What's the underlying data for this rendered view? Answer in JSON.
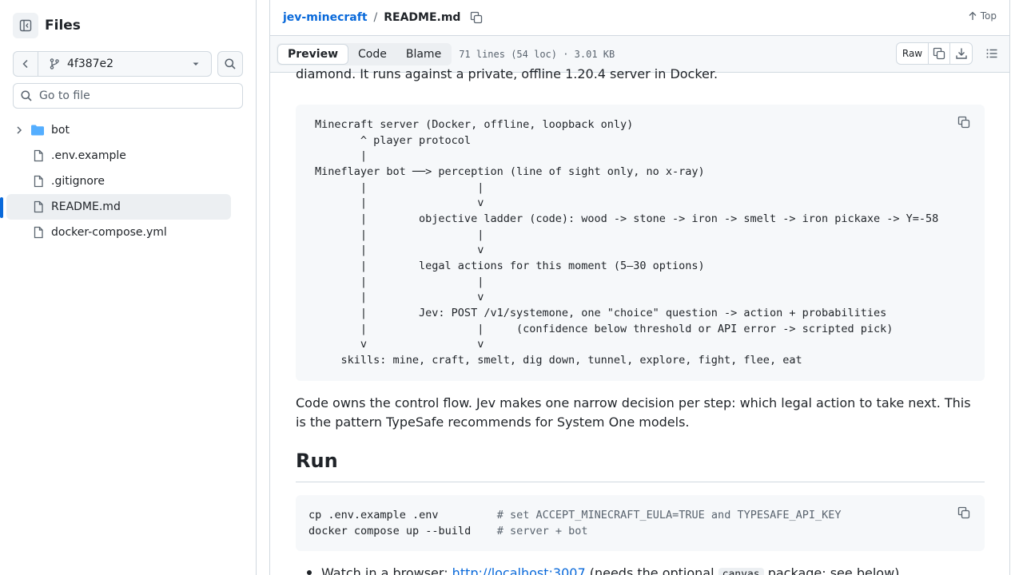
{
  "sidebar": {
    "title": "Files",
    "branch": "4f387e2",
    "goto_placeholder": "Go to file",
    "items": [
      {
        "label": "bot",
        "type": "folder"
      },
      {
        "label": ".env.example",
        "type": "file"
      },
      {
        "label": ".gitignore",
        "type": "file"
      },
      {
        "label": "README.md",
        "type": "file",
        "selected": true
      },
      {
        "label": "docker-compose.yml",
        "type": "file"
      }
    ]
  },
  "header": {
    "repo": "jev-minecraft",
    "separator": "/",
    "file": "README.md",
    "top_label": "Top"
  },
  "filebar": {
    "tabs": [
      "Preview",
      "Code",
      "Blame"
    ],
    "active_tab": "Preview",
    "meta": "71 lines (54 loc) · 3.01 KB",
    "raw_label": "Raw"
  },
  "content": {
    "intro_tail": "diamond. It runs against a private, offline 1.20.4 server in Docker.",
    "diagram": "Minecraft server (Docker, offline, loopback only)\n       ^ player protocol\n       |\nMineflayer bot ──> perception (line of sight only, no x-ray)\n       |                 |\n       |                 v\n       |        objective ladder (code): wood -> stone -> iron -> smelt -> iron pickaxe -> Y=-58\n       |                 |\n       |                 v\n       |        legal actions for this moment (5–30 options)\n       |                 |\n       |                 v\n       |        Jev: POST /v1/systemone, one \"choice\" question -> action + probabilities\n       |                 |     (confidence below threshold or API error -> scripted pick)\n       v                 v\n    skills: mine, craft, smelt, dig down, tunnel, explore, fight, flee, eat",
    "paragraph": "Code owns the control flow. Jev makes one narrow decision per step: which legal action to take next. This is the pattern TypeSafe recommends for System One models.",
    "heading": "Run",
    "cmd1": "cp .env.example .env",
    "cmd1_comment": "# set ACCEPT_MINECRAFT_EULA=TRUE and TYPESAFE_API_KEY",
    "cmd2": "docker compose up --build",
    "cmd2_comment": "# server + bot",
    "bullet_prefix": "Watch in a browser: ",
    "bullet_link": "http://localhost:3007",
    "bullet_mid": " (needs the optional ",
    "bullet_code": "canvas",
    "bullet_suffix": " package; see below)"
  },
  "colors": {
    "accent": "#0969da",
    "border": "#d1d9e0",
    "muted": "#59636e",
    "folder": "#54aeff"
  }
}
